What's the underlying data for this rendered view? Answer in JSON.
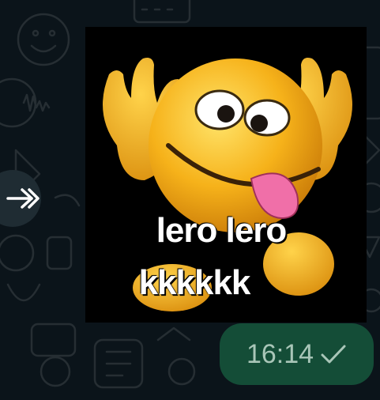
{
  "message": {
    "sticker_text": [
      "lero lero",
      "kkkkkk"
    ],
    "time": "16:14",
    "status_icon": "single-check-icon"
  },
  "forward": {
    "icon": "forward-arrow-icon"
  },
  "colors": {
    "chat_background": "#0b141a",
    "bubble": "#144d37",
    "time_text": "#a9c6b8",
    "forward_button": "#1f2c33",
    "emoji_face": "#f6b21a"
  }
}
